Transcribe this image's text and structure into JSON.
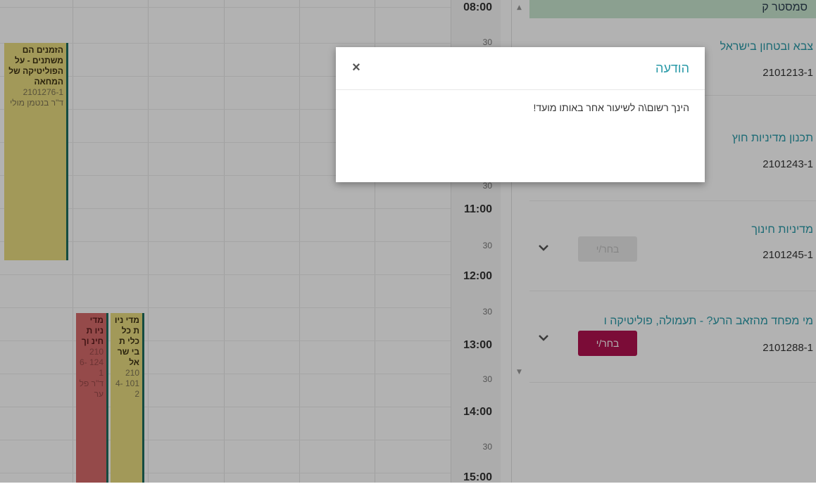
{
  "calendar": {
    "time_labels": [
      "08:00",
      "30",
      "",
      "30",
      "",
      "30",
      "",
      "30",
      "11:00",
      "30",
      "12:00",
      "30",
      "13:00",
      "30",
      "14:00",
      "30",
      "15:00"
    ],
    "events": [
      {
        "title": "הזמנים הם משתנים - על הפוליטיקה של המחאה",
        "code": "2101276-1",
        "lecturer": "ד\"ר בנטמן מולי",
        "color": "yellow"
      },
      {
        "title": "מדי ניו ת חינ וך",
        "code": "210 124 6-1",
        "lecturer": "ד\"ר פל ער",
        "color": "red"
      },
      {
        "title": "מדי ניו ת כל כלי ת בי שר אל",
        "code": "210 101 4-2",
        "lecturer": "",
        "color": "yellow"
      }
    ]
  },
  "list": {
    "semester": "סמסטר ק",
    "courses": [
      {
        "name": "צבא ובטחון בישראל",
        "code": "2101213-1"
      },
      {
        "name": "תכנון מדיניות חוץ",
        "code": "2101243-1"
      },
      {
        "name": "מדיניות חינוך",
        "code": "2101245-1",
        "button": "בחר/י"
      },
      {
        "name": "מי מפחד מהזאב הרע? - תעמולה, פוליטיקה ו",
        "code": "2101288-1",
        "button": "בחר/י"
      }
    ]
  },
  "modal": {
    "title": "הודעה",
    "close": "×",
    "message": "הינך רשום\\ה לשיעור אחר באותו מועד!"
  },
  "colors": {
    "accent": "#2a9aa8",
    "choose_active": "#b0124f",
    "event_yellow": "#e9dc80",
    "event_red": "#d66a6a",
    "event_border": "#1f6e5d",
    "semester_bg": "#c8e6cf"
  },
  "icons": [
    "close-icon",
    "chevron-down-icon",
    "scroll-up-icon",
    "scroll-down-icon"
  ]
}
